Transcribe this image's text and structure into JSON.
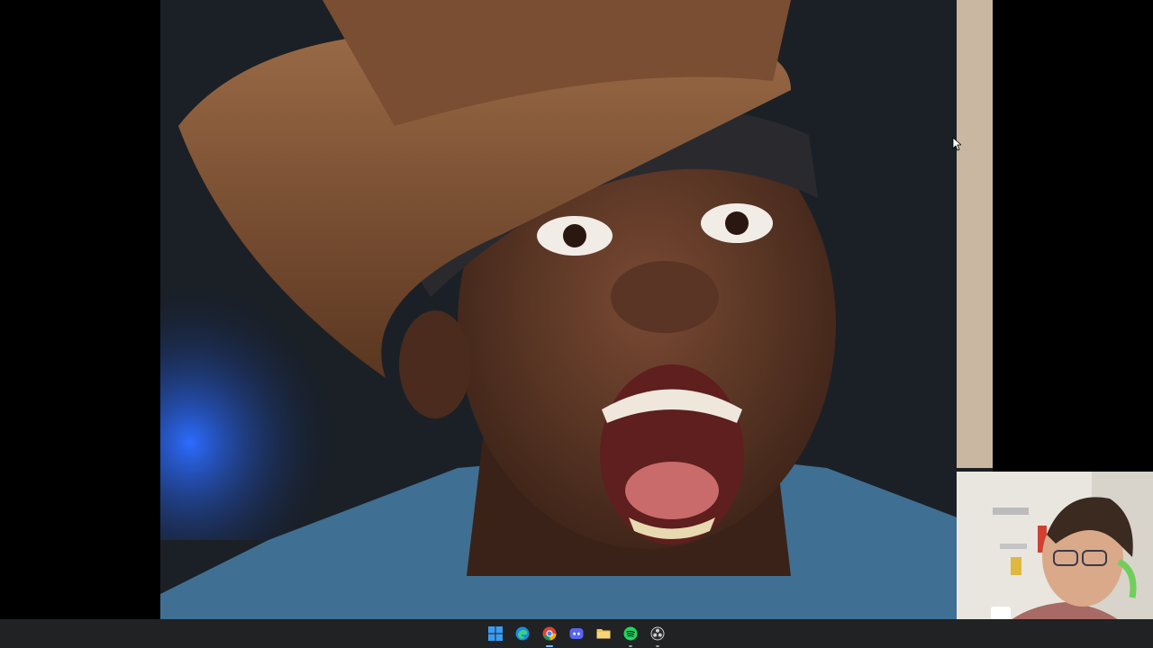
{
  "screen": {
    "background": "#000000"
  },
  "photo": {
    "description_icon": "photo-content"
  },
  "taskbar": {
    "background": "#202224",
    "accent": "#7ab7ff",
    "items": [
      {
        "name": "start",
        "icon": "windows-icon"
      },
      {
        "name": "edge",
        "icon": "edge-icon"
      },
      {
        "name": "chrome",
        "icon": "chrome-icon"
      },
      {
        "name": "discord",
        "icon": "discord-icon"
      },
      {
        "name": "file-explorer",
        "icon": "folder-icon"
      },
      {
        "name": "spotify",
        "icon": "spotify-icon"
      },
      {
        "name": "obs",
        "icon": "obs-icon"
      }
    ]
  },
  "webcam": {
    "icon": "webcam-feed"
  }
}
